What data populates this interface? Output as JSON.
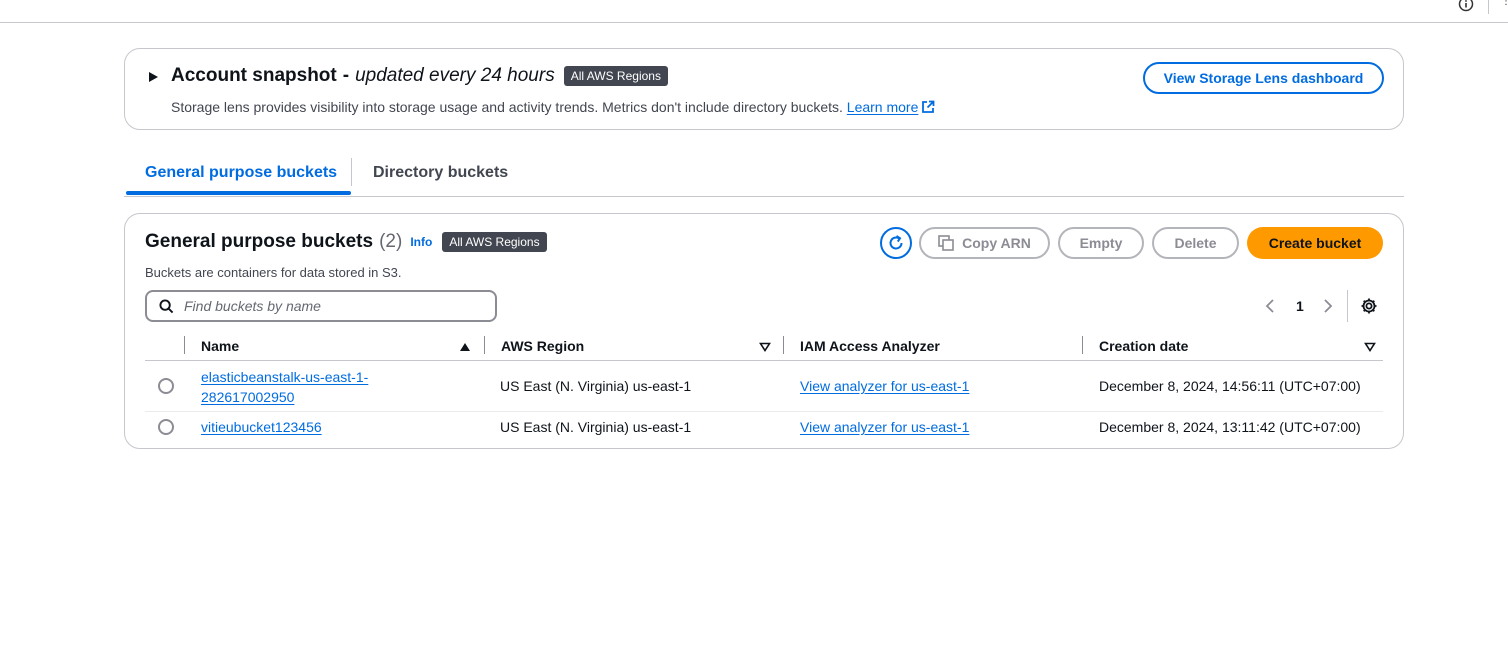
{
  "snapshot": {
    "title": "Account snapshot",
    "dash": "-",
    "subtitle": "updated every 24 hours",
    "badge": "All AWS Regions",
    "description": "Storage lens provides visibility into storage usage and activity trends. Metrics don't include directory buckets.",
    "learn_more": "Learn more",
    "dashboard_button": "View Storage Lens dashboard"
  },
  "tabs": [
    {
      "label": "General purpose buckets",
      "active": true
    },
    {
      "label": "Directory buckets",
      "active": false
    }
  ],
  "panel": {
    "title": "General purpose buckets",
    "count": "(2)",
    "info": "Info",
    "badge": "All AWS Regions",
    "description": "Buckets are containers for data stored in S3.",
    "buttons": {
      "copy_arn": "Copy ARN",
      "empty": "Empty",
      "delete": "Delete",
      "create": "Create bucket"
    },
    "search_placeholder": "Find buckets by name",
    "page": "1"
  },
  "table": {
    "columns": [
      "Name",
      "AWS Region",
      "IAM Access Analyzer",
      "Creation date"
    ],
    "rows": [
      {
        "name": "elasticbeanstalk-us-east-1-282617002950",
        "region": "US East (N. Virginia) us-east-1",
        "analyzer": "View analyzer for us-east-1",
        "created": "December 8, 2024, 14:56:11 (UTC+07:00)"
      },
      {
        "name": "vitieubucket123456",
        "region": "US East (N. Virginia) us-east-1",
        "analyzer": "View analyzer for us-east-1",
        "created": "December 8, 2024, 13:11:42 (UTC+07:00)"
      }
    ]
  },
  "colors": {
    "link": "#006ce0",
    "primary_button": "#ff9900",
    "badge_bg": "#424650",
    "border": "#c6c6cd"
  }
}
